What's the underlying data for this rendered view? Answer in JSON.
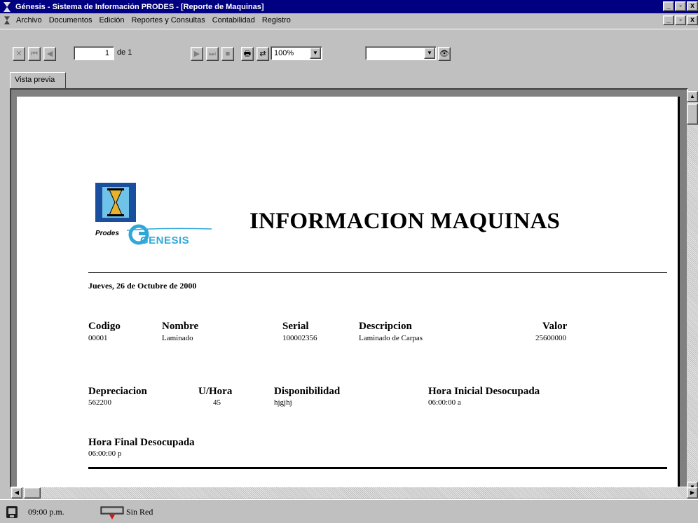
{
  "window": {
    "title": "Génesis - Sistema de Información PRODES - [Reporte de Maquinas]",
    "min_label": "_",
    "max_label": "ð",
    "close_label": "x"
  },
  "menu": {
    "items": [
      "Archivo",
      "Documentos",
      "Edición",
      "Reportes y Consultas",
      "Contabilidad",
      "Registro"
    ]
  },
  "toolbar": {
    "page_value": "1",
    "page_of": "de 1",
    "zoom_value": "100%",
    "search_value": ""
  },
  "tab": {
    "label": "Vista previa"
  },
  "report": {
    "logo_brand": "Prodes",
    "logo_name": "GENESIS",
    "title": "INFORMACION MAQUINAS",
    "date": "Jueves, 26 de Octubre de 2000",
    "fields": {
      "codigo": {
        "label": "Codigo",
        "value": "00001"
      },
      "nombre": {
        "label": "Nombre",
        "value": "Laminado"
      },
      "serial": {
        "label": "Serial",
        "value": "100002356"
      },
      "descripcion": {
        "label": "Descripcion",
        "value": "Laminado de Carpas"
      },
      "valor": {
        "label": "Valor",
        "value": "25600000"
      },
      "depreciacion": {
        "label": "Depreciacion",
        "value": "562200"
      },
      "uhora": {
        "label": "U/Hora",
        "value": "45"
      },
      "disponibilidad": {
        "label": "Disponibilidad",
        "value": "hjgjhj"
      },
      "hora_inicial": {
        "label": "Hora Inicial Desocupada",
        "value": "06:00:00 a"
      },
      "hora_final": {
        "label": "Hora Final Desocupada",
        "value": "06:00:00 p"
      }
    }
  },
  "status": {
    "time": "09:00 p.m.",
    "network": "Sin Red"
  },
  "colors": {
    "titlebar": "#000080",
    "face": "#c0c0c0",
    "logo_blue": "#1a4fa0",
    "logo_cyan": "#2fa8d8"
  }
}
